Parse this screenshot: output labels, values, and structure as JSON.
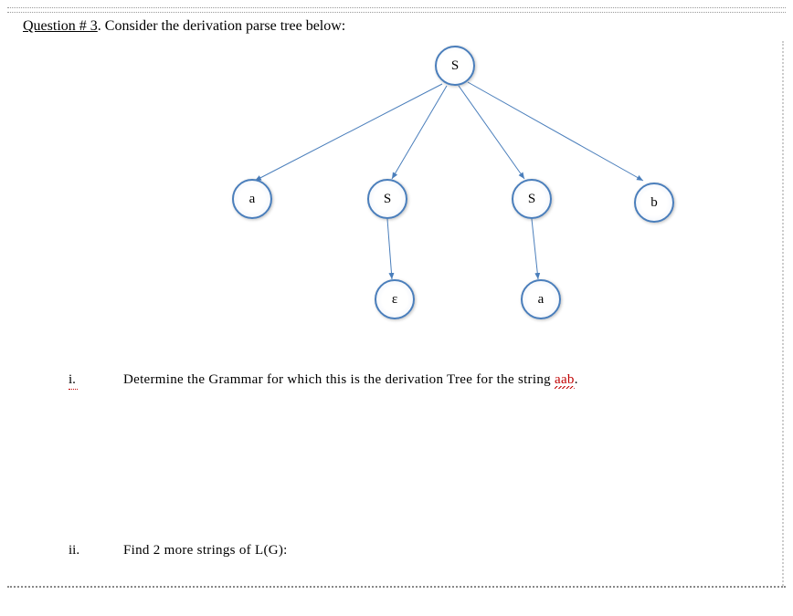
{
  "question": {
    "header_prefix": "Question # 3",
    "header_rest": ". Consider the derivation parse tree below:"
  },
  "tree": {
    "root": "S",
    "level1": {
      "a": "a",
      "S1": "S",
      "S2": "S",
      "b": "b"
    },
    "level2": {
      "eps": "ε",
      "a": "a"
    }
  },
  "parts": {
    "i_marker": "i.",
    "i_text_a": "Determine the Grammar for which this is the derivation Tree for the string ",
    "i_text_b": "aab",
    "i_text_c": ".",
    "ii_marker": "ii.",
    "ii_text": "Find 2 more strings of L(G):"
  }
}
